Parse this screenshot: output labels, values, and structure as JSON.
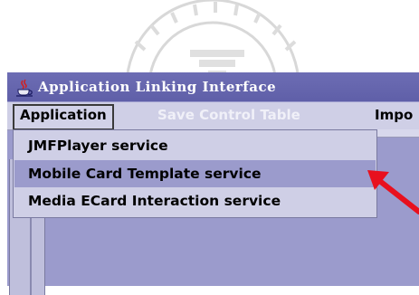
{
  "window": {
    "title": "Application Linking Interface"
  },
  "menubar": {
    "items": [
      {
        "label": "Application",
        "state": "active"
      },
      {
        "label": "Save Control Table",
        "state": "disabled"
      },
      {
        "label": "Impo",
        "state": "clipped"
      }
    ]
  },
  "popup": {
    "items": [
      {
        "label": "JMFPlayer service",
        "selected": false
      },
      {
        "label": "Mobile Card Template service",
        "selected": true
      },
      {
        "label": "Media ECard Interaction service",
        "selected": false
      }
    ]
  },
  "colors": {
    "titlebar": "#6d6db4",
    "menu_bg": "#cfcfe6",
    "selection": "#9b9bcc",
    "desktop": "#9b9bcc",
    "arrow": "#e8101e"
  },
  "icons": {
    "title": "java-cup-icon",
    "annotation": "red-arrow-icon",
    "watermark": "seal-watermark"
  }
}
